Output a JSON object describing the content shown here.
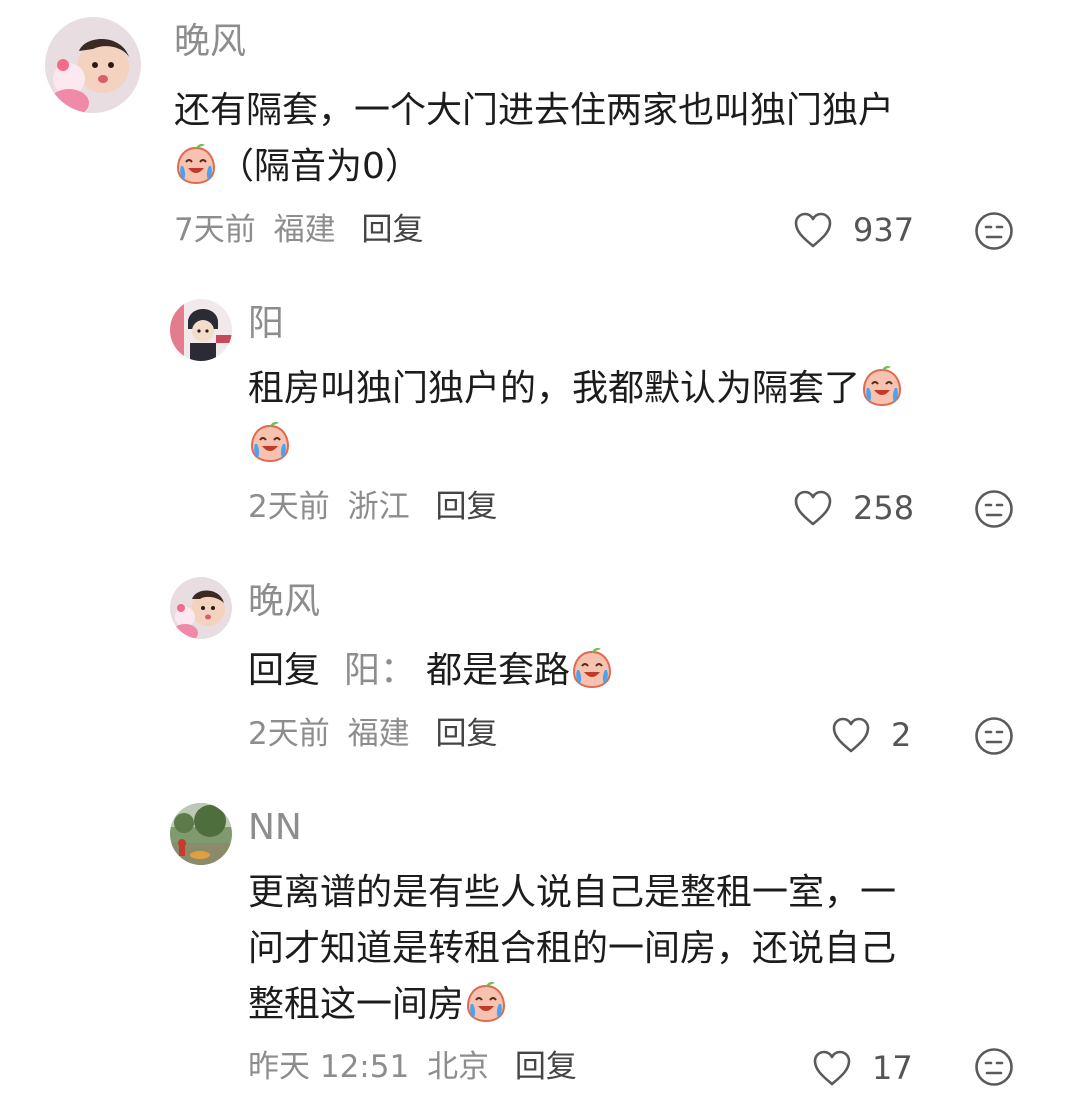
{
  "comments": [
    {
      "username": "晚风",
      "text_line1": "还有隔套，一个大门进去住两家也叫独门独户",
      "text_line2": "（隔音为0）",
      "time": "7天前",
      "location": "福建",
      "reply_label": "回复",
      "likes": "937",
      "emoji": "crying-laughing-peach-emoji"
    },
    {
      "username": "阳",
      "text_line1": "租房叫独门独户的，我都默认为隔套了",
      "time": "2天前",
      "location": "浙江",
      "reply_label": "回复",
      "likes": "258",
      "emoji": "crying-laughing-peach-emoji"
    },
    {
      "username": "晚风",
      "reply_prefix": "回复",
      "reply_target": "阳：",
      "text_line1": "都是套路",
      "time": "2天前",
      "location": "福建",
      "reply_label": "回复",
      "likes": "2",
      "emoji": "crying-laughing-peach-emoji"
    },
    {
      "username": "NN",
      "text_line1": "更离谱的是有些人说自己是整租一室，一",
      "text_line2": "问才知道是转租合租的一间房，还说自己",
      "text_line3": "整租这一间房",
      "time": "昨天 12:51",
      "location": "北京",
      "reply_label": "回复",
      "likes": "17",
      "emoji": "crying-laughing-peach-emoji"
    }
  ],
  "icons": {
    "like": "heart-outline-icon",
    "dislike": "neutral-face-icon"
  },
  "colors": {
    "text": "#1c1c1c",
    "meta": "#8d8d8d",
    "icon": "#555555"
  }
}
